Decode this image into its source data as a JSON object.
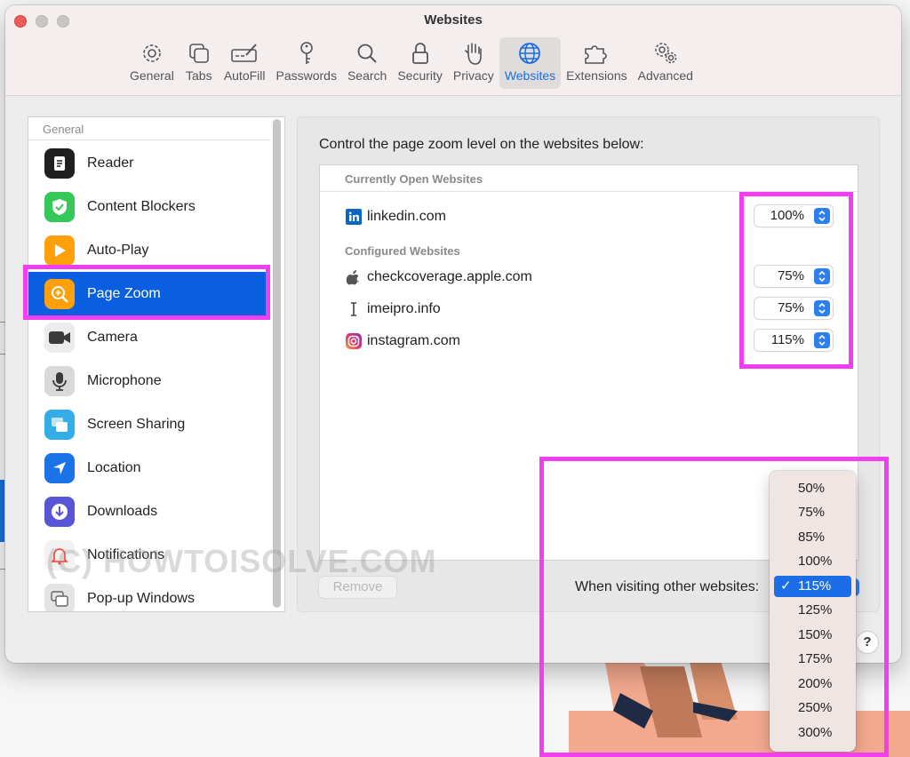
{
  "window": {
    "title": "Websites"
  },
  "toolbar": {
    "items": [
      {
        "label": "General",
        "icon": "gear-icon"
      },
      {
        "label": "Tabs",
        "icon": "tabs-icon"
      },
      {
        "label": "AutoFill",
        "icon": "pen-form-icon"
      },
      {
        "label": "Passwords",
        "icon": "key-icon"
      },
      {
        "label": "Search",
        "icon": "magnifier-icon"
      },
      {
        "label": "Security",
        "icon": "lock-icon"
      },
      {
        "label": "Privacy",
        "icon": "hand-icon"
      },
      {
        "label": "Websites",
        "icon": "globe-icon",
        "active": true
      },
      {
        "label": "Extensions",
        "icon": "puzzle-icon"
      },
      {
        "label": "Advanced",
        "icon": "gears-icon"
      }
    ]
  },
  "sidebar": {
    "section": "General",
    "items": [
      {
        "label": "Reader",
        "icon": "reader-icon",
        "color": "#1f1f1f"
      },
      {
        "label": "Content Blockers",
        "icon": "shield-check-icon",
        "color": "#34c759"
      },
      {
        "label": "Auto-Play",
        "icon": "play-icon",
        "color": "#ff9f0a"
      },
      {
        "label": "Page Zoom",
        "icon": "zoom-in-icon",
        "color": "#ff9f0a",
        "selected": true
      },
      {
        "label": "Camera",
        "icon": "camera-icon",
        "color": "#3a3a3a"
      },
      {
        "label": "Microphone",
        "icon": "microphone-icon",
        "color": "#8e8e93"
      },
      {
        "label": "Screen Sharing",
        "icon": "screen-sharing-icon",
        "color": "#32ade6"
      },
      {
        "label": "Location",
        "icon": "location-arrow-icon",
        "color": "#1a73e8"
      },
      {
        "label": "Downloads",
        "icon": "download-icon",
        "color": "#5856d6"
      },
      {
        "label": "Notifications",
        "icon": "bell-icon",
        "color": "#ff3b30"
      },
      {
        "label": "Pop-up Windows",
        "icon": "popup-windows-icon",
        "color": "#8e8e93"
      }
    ]
  },
  "content": {
    "heading": "Control the page zoom level on the websites below:",
    "open_header": "Currently Open Websites",
    "configured_header": "Configured Websites",
    "open_sites": [
      {
        "name": "linkedin.com",
        "zoom": "100%",
        "icon": "linkedin-icon"
      }
    ],
    "configured_sites": [
      {
        "name": "checkcoverage.apple.com",
        "zoom": "75%",
        "icon": "apple-icon"
      },
      {
        "name": "imeipro.info",
        "zoom": "75%",
        "icon": "text-cursor-icon"
      },
      {
        "name": "instagram.com",
        "zoom": "115%",
        "icon": "instagram-icon"
      }
    ],
    "remove_label": "Remove",
    "other_label": "When visiting other websites:"
  },
  "zoom_menu": {
    "options": [
      "50%",
      "75%",
      "85%",
      "100%",
      "115%",
      "125%",
      "150%",
      "175%",
      "200%",
      "250%",
      "300%"
    ],
    "selected": "115%",
    "check_mark": "✓"
  },
  "help": {
    "label": "?"
  },
  "watermark": {
    "text": "(C) HOWTOISOLVE.COM"
  },
  "colors": {
    "highlight": "#f03ef0",
    "accent": "#0a5fe0"
  }
}
